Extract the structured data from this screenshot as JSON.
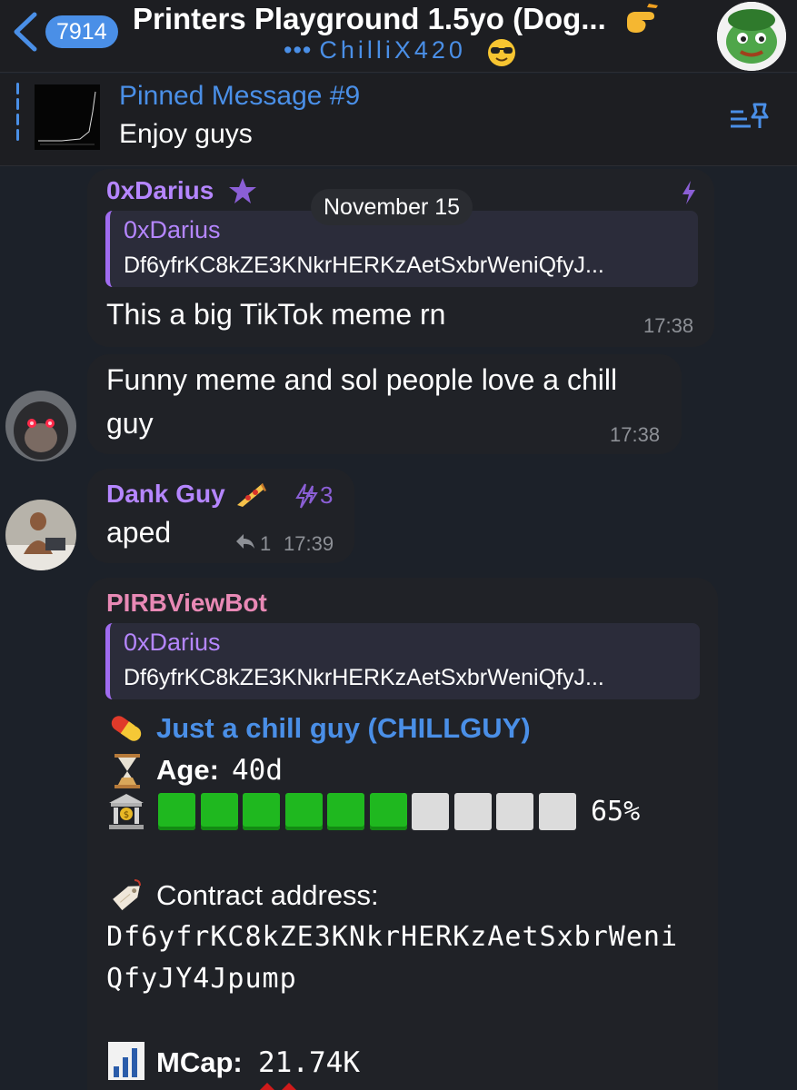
{
  "header": {
    "unread_count": "7914",
    "title": "Printers Playground 1.5yo (Dog...",
    "subtitle_dots": "•••",
    "subtitle": "ChilliX420",
    "icons": [
      "back-chevron-icon",
      "hand-point-icon",
      "sunglasses-face-icon",
      "group-avatar"
    ]
  },
  "pinned": {
    "label": "Pinned Message #9",
    "text": "Enjoy guys",
    "icon": "pin-list-icon"
  },
  "date_chip": "November 15",
  "messages": [
    {
      "sender": "0xDarius",
      "reply_name": "0xDarius",
      "reply_text": "Df6yfrKC8kZE3KNkrHERKzAetSxbrWeniQfyJ...",
      "text": "This a big TikTok meme rn",
      "time": "17:38"
    },
    {
      "text_line1": "Funny meme and sol people love a chill",
      "text_line2": "guy",
      "time": "17:38"
    },
    {
      "sender": "Dank Guy",
      "boost": "3",
      "text": "aped",
      "replies": "1",
      "time": "17:39"
    },
    {
      "sender": "PIRBViewBot",
      "reply_name": "0xDarius",
      "reply_text": "Df6yfrKC8kZE3KNkrHERKzAetSxbrWeniQfyJ...",
      "token": "Just a chill guy (CHILLGUY)",
      "age_label": "Age:",
      "age_value": "40d",
      "bonding_progress": 0.65,
      "bonding_percent": "65%",
      "contract_label": "Contract address:",
      "contract_line1": "Df6yfrKC8kZE3KNkrHERKzAetSxbrWeni",
      "contract_line2": "QfyJY4Jpump",
      "mcap_label": "MCap:",
      "mcap_value": "21.74K"
    }
  ],
  "colors": {
    "accent_blue": "#4a8fe7",
    "name_purple": "#b586ff",
    "bot_pink": "#e889b5",
    "bar_green": "#1fb81f",
    "bar_empty": "#dcdcdc",
    "background": "#1c2129",
    "bubble": "#202227"
  }
}
